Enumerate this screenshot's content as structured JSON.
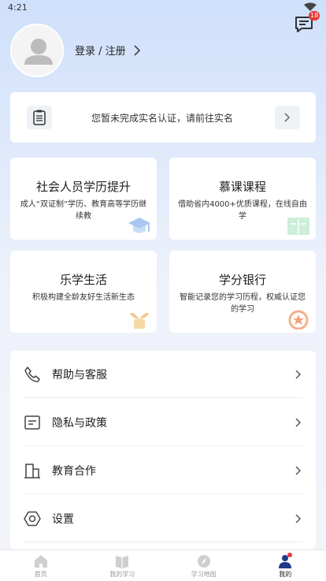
{
  "status_bar": {
    "time": "4:21"
  },
  "header": {
    "message_badge": "18",
    "login_label": "登录 / 注册"
  },
  "verify_banner": {
    "text": "您暂未完成实名认证，请前往实名"
  },
  "features": [
    {
      "title": "社会人员学历提升",
      "desc": "成人“双证制”学历、教育高等学历继续教",
      "icon": "graduation-cap-icon",
      "accent": "#aac8f0"
    },
    {
      "title": "慕课课程",
      "desc": "借助省内4000+优质课程，在线自由学",
      "icon": "open-book-icon",
      "accent": "#b7e3c6"
    },
    {
      "title": "乐学生活",
      "desc": "积极构建全龄友好生活新生态",
      "icon": "plant-sprout-icon",
      "accent": "#f6d9a5"
    },
    {
      "title": "学分银行",
      "desc": "智能记录您的学习历程，权威认证您的学习",
      "icon": "star-medal-icon",
      "accent": "#f3c2a5"
    }
  ],
  "menu": [
    {
      "label": "帮助与客服",
      "icon": "phone-icon"
    },
    {
      "label": "隐私与政策",
      "icon": "document-icon"
    },
    {
      "label": "教育合作",
      "icon": "building-icon"
    },
    {
      "label": "设置",
      "icon": "settings-hexagon-icon"
    }
  ],
  "tabs": [
    {
      "label": "首页",
      "icon": "home-icon"
    },
    {
      "label": "我的学习",
      "icon": "book-icon"
    },
    {
      "label": "学习地图",
      "icon": "compass-icon"
    },
    {
      "label": "我的",
      "icon": "user-icon"
    }
  ]
}
